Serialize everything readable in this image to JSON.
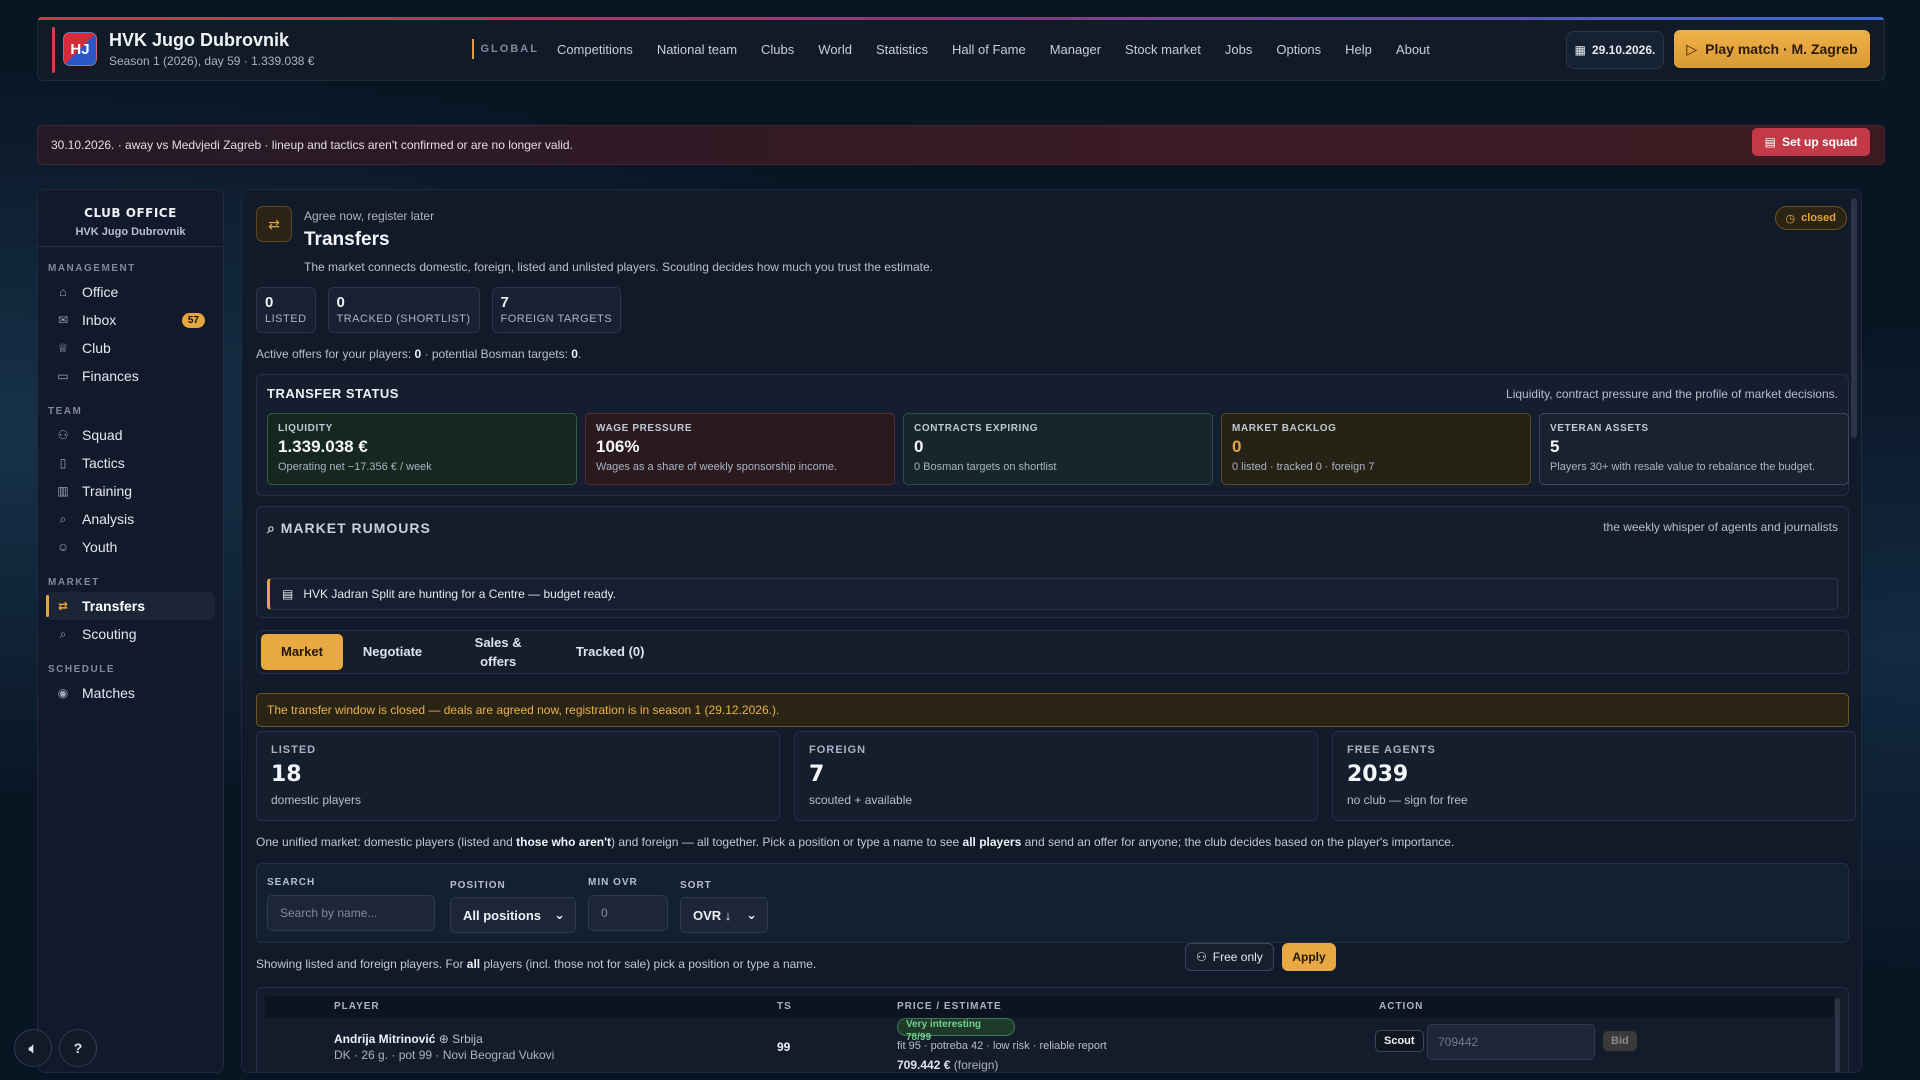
{
  "header": {
    "badge": "HJ",
    "club_name": "HVK Jugo Dubrovnik",
    "club_sub": "Season 1 (2026), day 59 · 1.339.038 €",
    "nav_global": "GLOBAL",
    "nav_items": [
      "Competitions",
      "National team",
      "Clubs",
      "World",
      "Statistics",
      "Hall of Fame",
      "Manager",
      "Stock market",
      "Jobs",
      "Options",
      "Help",
      "About"
    ],
    "date": "29.10.2026.",
    "play_label": "Play match · M. Zagreb"
  },
  "banner": {
    "text": "30.10.2026. · away vs Medvjedi Zagreb · lineup and tactics aren't confirmed or are no longer valid.",
    "button": "Set up squad"
  },
  "sidebar": {
    "title": "CLUB OFFICE",
    "club": "HVK Jugo Dubrovnik",
    "sections": [
      {
        "label": "MANAGEMENT",
        "items": [
          {
            "label": "Office",
            "icon": "home-icon"
          },
          {
            "label": "Inbox",
            "icon": "mail-icon",
            "badge": "57"
          },
          {
            "label": "Club",
            "icon": "trophy-icon"
          },
          {
            "label": "Finances",
            "icon": "wallet-icon"
          }
        ]
      },
      {
        "label": "TEAM",
        "items": [
          {
            "label": "Squad",
            "icon": "people-icon"
          },
          {
            "label": "Tactics",
            "icon": "clipboard-icon"
          },
          {
            "label": "Training",
            "icon": "bar-chart-icon"
          },
          {
            "label": "Analysis",
            "icon": "magnifier-icon"
          },
          {
            "label": "Youth",
            "icon": "person-icon"
          }
        ]
      },
      {
        "label": "MARKET",
        "items": [
          {
            "label": "Transfers",
            "icon": "transfer-icon",
            "active": true
          },
          {
            "label": "Scouting",
            "icon": "magnifier-icon"
          }
        ]
      },
      {
        "label": "SCHEDULE",
        "items": [
          {
            "label": "Matches",
            "icon": "target-icon"
          }
        ]
      }
    ]
  },
  "main": {
    "kicker": "Agree now, register later",
    "title": "Transfers",
    "desc": "The market connects domestic, foreign, listed and unlisted players. Scouting decides how much you trust the estimate.",
    "status_chip": "closed",
    "kpis": [
      {
        "value": "0",
        "label": "LISTED"
      },
      {
        "value": "0",
        "label": "TRACKED (SHORTLIST)"
      },
      {
        "value": "7",
        "label": "FOREIGN TARGETS"
      }
    ],
    "active_offers_pre": "Active offers for your players: ",
    "active_offers_val": "0",
    "bosman_pre": " · potential Bosman targets: ",
    "bosman_val": "0",
    "transfer_status": {
      "title": "TRANSFER STATUS",
      "note": "Liquidity, contract pressure and the profile of market decisions.",
      "cards": [
        {
          "label": "LIQUIDITY",
          "value": "1.339.038 €",
          "desc": "Operating net −17.356 € / week"
        },
        {
          "label": "WAGE PRESSURE",
          "value": "106%",
          "desc": "Wages as a share of weekly sponsorship income."
        },
        {
          "label": "CONTRACTS EXPIRING",
          "value": "0",
          "desc": "0 Bosman targets on shortlist"
        },
        {
          "label": "MARKET BACKLOG",
          "value": "0",
          "desc": "0 listed · tracked 0 · foreign 7"
        },
        {
          "label": "VETERAN ASSETS",
          "value": "5",
          "desc": "Players 30+ with resale value to rebalance the budget."
        }
      ]
    },
    "rumours": {
      "title": "MARKET RUMOURS",
      "note": "the weekly whisper of agents and journalists",
      "item": "HVK Jadran Split are hunting for a Centre — budget ready."
    },
    "tabs": [
      "Market",
      "Negotiate",
      "Sales & offers",
      "Tracked (0)"
    ],
    "window_note": "The transfer window is closed — deals are agreed now, registration is in season 1 (29.12.2026.).",
    "stats": [
      {
        "label": "LISTED",
        "value": "18",
        "desc": "domestic players"
      },
      {
        "label": "FOREIGN",
        "value": "7",
        "desc": "scouted + available"
      },
      {
        "label": "FREE AGENTS",
        "value": "2039",
        "desc": "no club — sign for free"
      }
    ],
    "unified": {
      "p1": "One unified market: domestic players (listed and ",
      "b1": "those who aren't",
      "p2": ") and foreign — all together. Pick a position or type a name to see ",
      "b2": "all players",
      "p3": " and send an offer for anyone; the club decides based on the player's importance."
    },
    "filters": {
      "search_label": "SEARCH",
      "search_placeholder": "Search by name...",
      "position_label": "POSITION",
      "position_value": "All positions",
      "minovr_label": "MIN OVR",
      "minovr_placeholder": "0",
      "sort_label": "SORT",
      "sort_value": "OVR ↓",
      "free_only": "Free only",
      "apply": "Apply"
    },
    "showing": {
      "p1": "Showing listed and foreign players. For ",
      "b1": "all",
      "p2": " players (incl. those not for sale) pick a position or type a name."
    },
    "table": {
      "headers": [
        "PLAYER",
        "TS",
        "PRICE / ESTIMATE",
        "ACTION"
      ],
      "row": {
        "name": "Andrija Mitrinović",
        "country": "Srbija",
        "sub": "DK · 26 g. · pot 99 · Novi Beograd Vukovi",
        "ts": "99",
        "tag": "Very interesting 78/99",
        "estimate": "fit 95 · potreba 42 · low risk · reliable report",
        "price": "709.442 €",
        "price_note": "(foreign)",
        "scout": "Scout",
        "bid_placeholder": "709442",
        "bid": "Bid"
      }
    }
  }
}
